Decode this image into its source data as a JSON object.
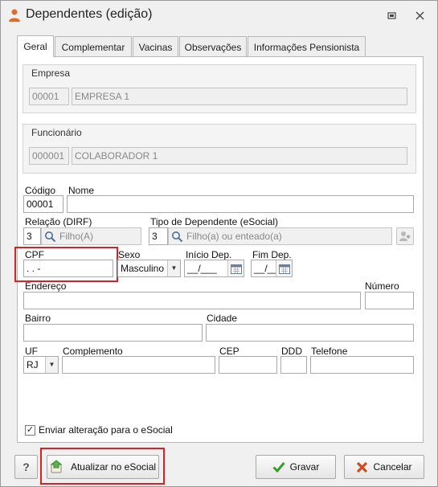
{
  "window": {
    "title": "Dependentes (edição)"
  },
  "tabs": [
    "Geral",
    "Complementar",
    "Vacinas",
    "Observações",
    "Informações Pensionista"
  ],
  "empresa": {
    "label": "Empresa",
    "code": "00001",
    "name": "EMPRESA 1"
  },
  "funcionario": {
    "label": "Funcionário",
    "code": "000001",
    "name": "COLABORADOR 1"
  },
  "form": {
    "codigo_label": "Código",
    "codigo_value": "00001",
    "nome_label": "Nome",
    "nome_value": "",
    "relacao_label": "Relação (DIRF)",
    "relacao_code": "3",
    "relacao_desc": "Filho(A)",
    "tipo_label": "Tipo de Dependente (eSocial)",
    "tipo_code": "3",
    "tipo_desc": "Filho(a) ou enteado(a)",
    "cpf_label": "CPF",
    "cpf_value": " .  .  -",
    "sexo_label": "Sexo",
    "sexo_value": "Masculino",
    "inicio_label": "Início Dep.",
    "inicio_value": "__/___",
    "fim_label": "Fim Dep.",
    "fim_value": "__/___",
    "endereco_label": "Endereço",
    "endereco_value": "",
    "numero_label": "Número",
    "numero_value": "",
    "bairro_label": "Bairro",
    "bairro_value": "",
    "cidade_label": "Cidade",
    "cidade_value": "",
    "uf_label": "UF",
    "uf_value": "RJ",
    "complemento_label": "Complemento",
    "complemento_value": "",
    "cep_label": "CEP",
    "cep_value": "",
    "ddd_label": "DDD",
    "ddd_value": "",
    "telefone_label": "Telefone",
    "telefone_value": ""
  },
  "checkbox": {
    "label": "Enviar alteração para o eSocial",
    "checked": true
  },
  "buttons": {
    "help": "?",
    "atualizar": "Atualizar no eSocial",
    "gravar": "Gravar",
    "cancelar": "Cancelar"
  },
  "colors": {
    "highlight": "#e02020",
    "gravar_icon": "#3a9a2a",
    "cancelar_icon": "#d94a1a"
  }
}
